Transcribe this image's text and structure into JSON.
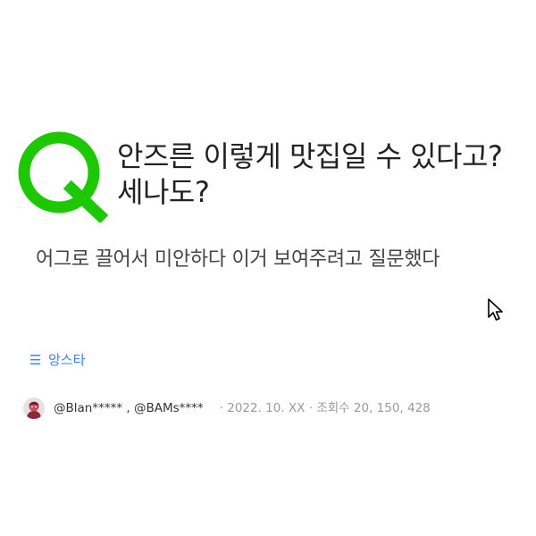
{
  "question": {
    "title": "안즈른 이렇게 맛집일 수 있다고? 세나도?",
    "body": "어그로 끌어서 미안하다 이거 보여주려고 질문했다"
  },
  "category": {
    "menu_icon": "menu-icon",
    "label": "앙스타"
  },
  "meta": {
    "users": "@Blan***** , @BAMs****",
    "date": "· 2022. 10. XX",
    "views_label": "· 조회수",
    "views_value": "20, 150, 428"
  },
  "colors": {
    "logo": "#1ec800",
    "category": "#4a7ef0",
    "meta_gray": "#9a9a9a"
  }
}
